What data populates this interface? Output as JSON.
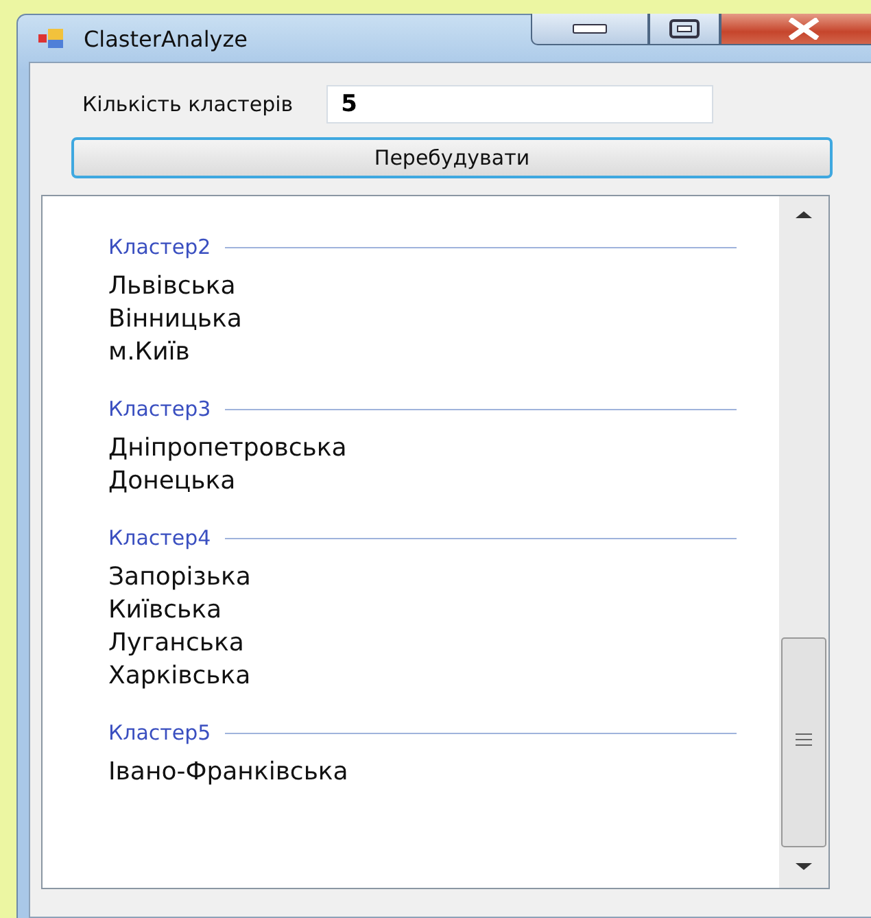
{
  "window": {
    "title": "ClasterAnalyze"
  },
  "cluster_count": {
    "label": "Кількість кластерів",
    "value": "5"
  },
  "rebuild_button": {
    "label": "Перебудувати"
  },
  "clusters": [
    {
      "name": "Кластер2",
      "items": [
        "Львівська",
        "Вінницька",
        "м.Київ"
      ]
    },
    {
      "name": "Кластер3",
      "items": [
        "Дніпропетровська",
        "Донецька"
      ]
    },
    {
      "name": "Кластер4",
      "items": [
        "Запорізька",
        "Київська",
        "Луганська",
        "Харківська"
      ]
    },
    {
      "name": "Кластер5",
      "items": [
        "Івано-Франківська"
      ]
    }
  ]
}
